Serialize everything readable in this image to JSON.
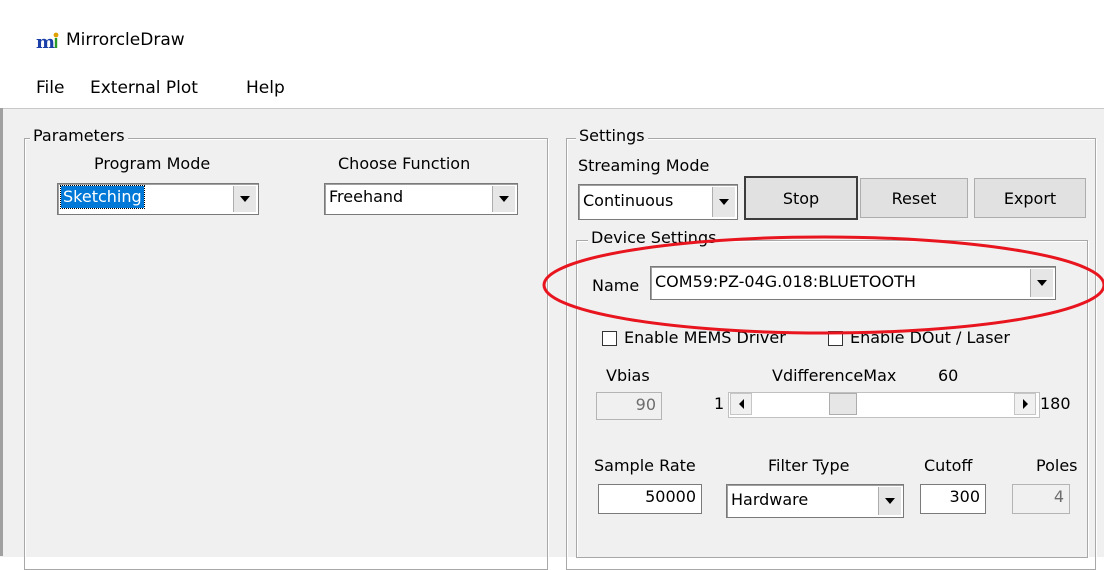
{
  "window": {
    "title": "MirrorcleDraw",
    "icon": "mirrorcle-app-icon"
  },
  "menu": [
    "File",
    "External Plot",
    "Help"
  ],
  "parameters": {
    "group_label": "Parameters",
    "program_mode_label": "Program Mode",
    "program_mode_value": "Sketching",
    "choose_function_label": "Choose Function",
    "choose_function_value": "Freehand"
  },
  "settings": {
    "group_label": "Settings",
    "streaming_mode_label": "Streaming Mode",
    "streaming_mode_value": "Continuous",
    "stop_label": "Stop",
    "reset_label": "Reset",
    "export_label": "Export",
    "device": {
      "group_label": "Device Settings",
      "name_label": "Name",
      "name_value": "COM59:PZ-04G.018:BLUETOOTH",
      "enable_mems_label": "Enable MEMS Driver",
      "enable_dout_label": "Enable DOut / Laser",
      "vbias_label": "Vbias",
      "vbias_value": "90",
      "vdiff_label": "VdifferenceMax",
      "vdiff_value": "60",
      "slider_min": "1",
      "slider_max": "180",
      "slider_level": 60,
      "sample_rate_label": "Sample Rate",
      "sample_rate_value": "50000",
      "filter_type_label": "Filter Type",
      "filter_type_value": "Hardware",
      "cutoff_label": "Cutoff",
      "cutoff_value": "300",
      "poles_label": "Poles",
      "poles_value": "4"
    }
  },
  "colors": {
    "highlight_ellipse": "#e8141e",
    "selection": "#0078d7",
    "dialog_bg": "#f0f0f0"
  }
}
